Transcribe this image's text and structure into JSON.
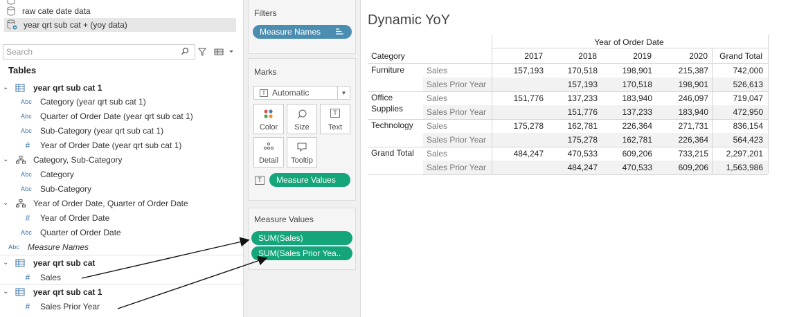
{
  "data_pane": {
    "datasources": [
      "raw cate date data",
      "year qrt sub cat + (yoy data)"
    ],
    "search_placeholder": "Search",
    "tables_heading": "Tables",
    "tables": [
      {
        "name": "year qrt sub cat 1",
        "fields": [
          "Category (year qrt sub cat 1)",
          "Quarter of Order Date (year qrt sub cat 1)",
          "Sub-Category (year qrt sub cat 1)",
          "Year of Order Date (year qrt sub cat 1)"
        ]
      },
      {
        "hierarchy": "Category, Sub-Category",
        "fields": [
          "Category",
          "Sub-Category"
        ]
      },
      {
        "hierarchy": "Year of Order Date, Quarter of Order Date",
        "fields": [
          "Year of Order Date",
          "Quarter of Order Date"
        ]
      },
      {
        "field": "Measure Names"
      },
      {
        "name": "year qrt sub cat",
        "fields": [
          "Sales"
        ]
      },
      {
        "name": "year qrt sub cat 1",
        "fields": [
          "Sales Prior Year"
        ]
      }
    ]
  },
  "shelves": {
    "filters_title": "Filters",
    "filter_pill": "Measure Names",
    "marks_title": "Marks",
    "mark_type": "Automatic",
    "mark_buttons": [
      "Color",
      "Size",
      "Text",
      "Detail",
      "Tooltip"
    ],
    "marks_pill": "Measure Values",
    "measure_values_title": "Measure Values",
    "measure_pills": [
      "SUM(Sales)",
      "SUM(Sales Prior Yea.."
    ]
  },
  "view": {
    "title": "Dynamic YoY",
    "column_header_group": "Year of Order Date",
    "row_header": "Category",
    "columns": [
      "2017",
      "2018",
      "2019",
      "2020",
      "Grand Total"
    ],
    "measures": [
      "Sales",
      "Sales Prior Year"
    ],
    "rows": [
      {
        "category": "Furniture",
        "sales": [
          "157,193",
          "170,518",
          "198,901",
          "215,387",
          "742,000"
        ],
        "prior": [
          "",
          "157,193",
          "170,518",
          "198,901",
          "526,613"
        ]
      },
      {
        "category": "Office Supplies",
        "category_lines": [
          "Office",
          "Supplies"
        ],
        "sales": [
          "151,776",
          "137,233",
          "183,940",
          "246,097",
          "719,047"
        ],
        "prior": [
          "",
          "151,776",
          "137,233",
          "183,940",
          "472,950"
        ]
      },
      {
        "category": "Technology",
        "sales": [
          "175,278",
          "162,781",
          "226,364",
          "271,731",
          "836,154"
        ],
        "prior": [
          "",
          "175,278",
          "162,781",
          "226,364",
          "564,423"
        ]
      },
      {
        "category": "Grand Total",
        "sales": [
          "484,247",
          "470,533",
          "609,206",
          "733,215",
          "2,297,201"
        ],
        "prior": [
          "",
          "484,247",
          "470,533",
          "609,206",
          "1,563,986"
        ]
      }
    ]
  }
}
